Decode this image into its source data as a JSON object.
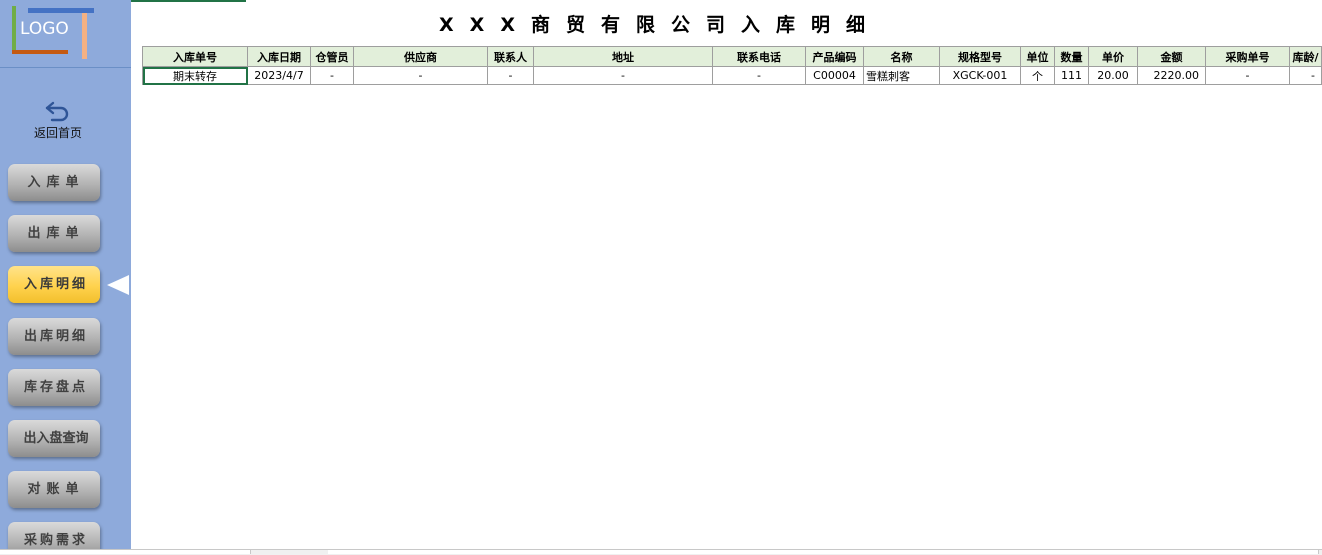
{
  "sidebar": {
    "logo_text": "LOGO",
    "back_label": "返回首页",
    "nav": [
      {
        "label": "入库单",
        "active": false
      },
      {
        "label": "出库单",
        "active": false
      },
      {
        "label": "入库明细",
        "active": true
      },
      {
        "label": "出库明细",
        "active": false
      },
      {
        "label": "库存盘点",
        "active": false
      },
      {
        "label": "出入盘查询",
        "active": false
      },
      {
        "label": "对账单",
        "active": false
      },
      {
        "label": "采购需求",
        "active": false
      }
    ]
  },
  "sheet": {
    "title": "XXX商贸有限公司入库明细",
    "columns": [
      "入库单号",
      "入库日期",
      "仓管员",
      "供应商",
      "联系人",
      "地址",
      "联系电话",
      "产品编码",
      "名称",
      "规格型号",
      "单位",
      "数量",
      "单价",
      "金额",
      "采购单号",
      "库龄/"
    ],
    "rows": [
      [
        "期末转存",
        "2023/4/7",
        "-",
        "-",
        "-",
        "-",
        "-",
        "C00004",
        "雪糕刺客",
        "XGCK-001",
        "个",
        "111",
        "20.00",
        "2220.00",
        "-",
        "-"
      ]
    ]
  },
  "colors": {
    "sidebar_bg": "#8eaadb",
    "header_bg": "#e2efda",
    "active_button": "#ffd24d",
    "selection": "#217346"
  }
}
